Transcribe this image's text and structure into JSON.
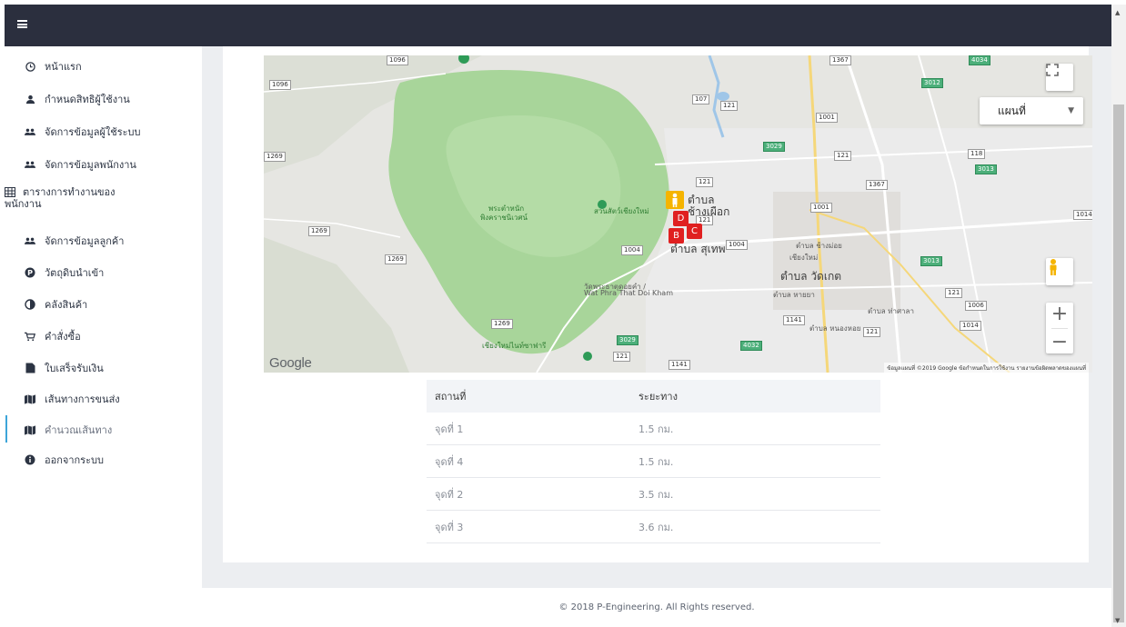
{
  "sidebar": {
    "items": [
      {
        "label": "หน้าแรก",
        "icon": "clock-icon"
      },
      {
        "label": "กำหนดสิทธิผู้ใช้งาน",
        "icon": "user-icon"
      },
      {
        "label": "จัดการข้อมูลผู้ใช้ระบบ",
        "icon": "users-icon"
      },
      {
        "label": "จัดการข้อมูลพนักงาน",
        "icon": "users-icon"
      },
      {
        "label": "ตารางการทำงานของ",
        "label2": "พนักงาน",
        "icon": "table-icon"
      },
      {
        "label": "จัดการข้อมูลลูกค้า",
        "icon": "users-icon"
      },
      {
        "label": "วัตถุดิบนำเข้า",
        "icon": "parking-icon"
      },
      {
        "label": "คลังสินค้า",
        "icon": "half-circle-icon"
      },
      {
        "label": "คำสั่งซื้อ",
        "icon": "cart-icon"
      },
      {
        "label": "ใบเสร็จรับเงิน",
        "icon": "file-icon"
      },
      {
        "label": "เส้นทางการขนส่ง",
        "icon": "map-icon"
      },
      {
        "label": "คำนวณเส้นทาง",
        "icon": "map-icon",
        "active": true
      },
      {
        "label": "ออกจากระบบ",
        "icon": "info-icon"
      }
    ]
  },
  "map": {
    "type_select": "แผนที่",
    "google": "Google",
    "attribution": "ข้อมูลแผนที่ ©2019 Google   ข้อกำหนดในการใช้งาน   รายงานข้อผิดพลาดของแผนที่",
    "markers": [
      "D",
      "B",
      "C"
    ],
    "labels": {
      "tambon_chang_phueak_1": "ตำบล",
      "tambon_chang_phueak_2": "ช้างเผือก",
      "tambon_suthep": "ตำบล สุเทพ",
      "tambon_wat_ket": "ตำบล วัดเกต",
      "zoo": "สวนสัตว์เชียงใหม่",
      "palace_1": "พระตำหนัก",
      "palace_2": "พิงคราชนิเวศน์",
      "wat_doi_kham_1": "วัดพระธาตุดอยคำ /",
      "wat_doi_kham_2": "Wat Phra That Doi Kham",
      "night_safari": "เชียงใหม่ไนท์ซาฟารี",
      "chiang_mai": "เชียงใหม่",
      "tambon_chang_moi": "ตำบล ช้างม่อย",
      "tambon_hai_ya": "ตำบล หายยา",
      "tambon_tha_sala": "ตำบล ท่าศาลา",
      "tambon_nong_hoi": "ตำบล หนองหอย"
    },
    "roads": [
      "1096",
      "1096",
      "107",
      "121",
      "1001",
      "1367",
      "4034",
      "3012",
      "3029",
      "121",
      "118",
      "3013",
      "1269",
      "121",
      "1367",
      "1001",
      "1014",
      "121",
      "1004",
      "1004",
      "1269",
      "1269",
      "3013",
      "121",
      "1006",
      "1141",
      "121",
      "1014",
      "1269",
      "3029",
      "4032",
      "121",
      "1141"
    ]
  },
  "table": {
    "headers": [
      "สถานที่",
      "ระยะทาง"
    ],
    "rows": [
      [
        "จุดที่ 1",
        "1.5 กม."
      ],
      [
        "จุดที่ 4",
        "1.5 กม."
      ],
      [
        "จุดที่ 2",
        "3.5 กม."
      ],
      [
        "จุดที่ 3",
        "3.6 กม."
      ]
    ]
  },
  "footer": {
    "text": "© 2018 P-Engineering. All Rights reserved."
  },
  "colors": {
    "topbar": "#2b2f3e",
    "active_accent": "#3da5d9",
    "content_bg": "#eceef1",
    "marker": "#e02020"
  }
}
